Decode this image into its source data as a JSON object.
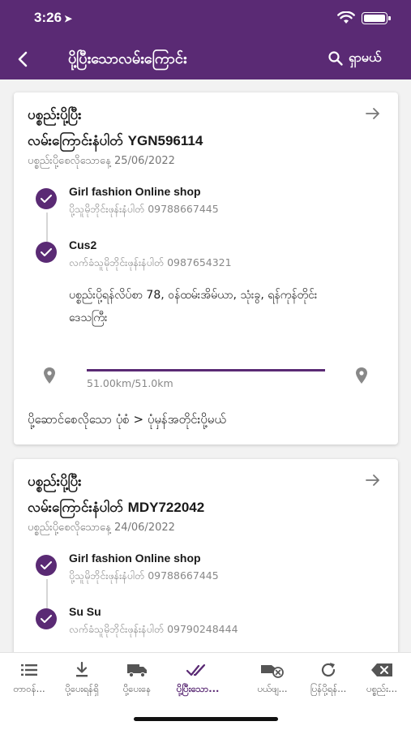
{
  "status_bar": {
    "time": "3:26"
  },
  "app_bar": {
    "title": "ပို့ပြီးသောလမ်းကြောင်း",
    "search_label": "ရှာမယ်"
  },
  "colors": {
    "brand": "#5a2a74",
    "card": "#ffffff",
    "background": "#f2f2f2"
  },
  "orders": [
    {
      "status_title": "ပစ္စည်းပို့ပြီး",
      "route_no_label": "လမ်းကြောင်းနံပါတ်",
      "route_no": "YGN596114",
      "date_label": "ပစ္စည်းပို့စေလိုသောနေ့",
      "date": "25/06/2022",
      "sender": {
        "name": "Girl fashion Online shop",
        "phone_label": "ပို့သူမိုဘိုင်းဖုန်းနံပါတ်",
        "phone": "09788667445"
      },
      "receiver": {
        "name": "Cus2",
        "phone_label": "လက်ခံသူမိုဘိုင်းဖုန်းနံပါတ်",
        "phone": "0987654321"
      },
      "address": "ပစ္စည်းပို့ရန်လိပ်စာ 78, ဝန်ထမ်းအိမ်ယာ, သုံးခွ, ရန်ကုန်တိုင်းဒေသကြီး",
      "distance": "51.00km/51.0km",
      "distance_progress": 1.0,
      "package": "ပို့ဆောင်စေလိုသော ပုံစံ > ပုံမှန်အတိုင်းပို့မယ်"
    },
    {
      "status_title": "ပစ္စည်းပို့ပြီး",
      "route_no_label": "လမ်းကြောင်းနံပါတ်",
      "route_no": "MDY722042",
      "date_label": "ပစ္စည်းပို့စေလိုသောနေ့",
      "date": "24/06/2022",
      "sender": {
        "name": "Girl fashion Online shop",
        "phone_label": "ပို့သူမိုဘိုင်းဖုန်းနံပါတ်",
        "phone": "09788667445"
      },
      "receiver": {
        "name": "Su Su",
        "phone_label": "လက်ခံသူမိုဘိုင်းဖုန်းနံပါတ်",
        "phone": "09790248444"
      }
    }
  ],
  "bottom_nav": [
    {
      "label": "တာဝန်...",
      "icon": "list-icon",
      "active": false
    },
    {
      "label": "ပို့ပေးရန်ရှိ",
      "icon": "download-icon",
      "active": false
    },
    {
      "label": "ပို့ပေးနေ",
      "icon": "truck-icon",
      "active": false
    },
    {
      "label": "ပို့ပြီးသော...",
      "icon": "double-check-icon",
      "active": true
    },
    {
      "label": "ပယ်ဖျ...",
      "icon": "cancelled-delivery-icon",
      "active": false
    },
    {
      "label": "ပြန်ပို့ရန်...",
      "icon": "refresh-icon",
      "active": false
    },
    {
      "label": "ပစ္စည်း...",
      "icon": "backspace-icon",
      "active": false
    }
  ]
}
